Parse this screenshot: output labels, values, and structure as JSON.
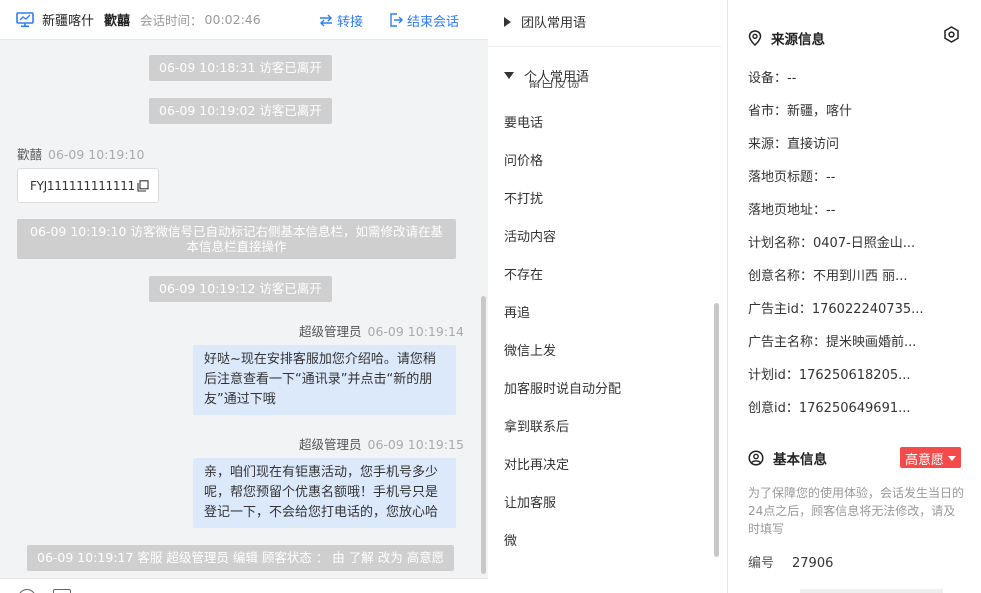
{
  "header": {
    "visitor_region": "新疆喀什",
    "agent_nick": "歡囍",
    "session_label": "会话时间：",
    "session_time": "00:02:46",
    "transfer": "转接",
    "end_session": "结束会话"
  },
  "chat": {
    "sys1": "06-09 10:18:31 访客已离开",
    "sys2": "06-09 10:19:02 访客已离开",
    "msg1_sender": "歡囍",
    "msg1_time": "06-09 10:19:10",
    "msg1_text": "FYJ111111111111",
    "sys3_line1": "06-09 10:19:10 访客微信号已自动标记右侧基本信息栏，如需修改请在基",
    "sys3_line2": "本信息栏直接操作",
    "sys4": "06-09 10:19:12 访客已离开",
    "msg2_sender": "超级管理员",
    "msg2_time": "06-09 10:19:14",
    "msg2_line1": "好哒~现在安排客服加您介绍哈。请您稍",
    "msg2_line2": "后注意查看一下“通讯录”并点击“新的朋",
    "msg2_line3": "友”通过下哦",
    "msg3_sender": "超级管理员",
    "msg3_time": "06-09 10:19:15",
    "msg3_line1": "亲，咱们现在有钜惠活动，您手机号多少",
    "msg3_line2": "呢，帮您预留个优惠名额哦！手机号只是",
    "msg3_line3": "登记一下，不会给您打电话的，您放心哈",
    "sys5": "06-09 10:19:17 客服 超级管理员 编辑 顾客状态 ： 由 了解 改为 高意愿"
  },
  "phrases": {
    "team_group": "团队常用语",
    "personal_group": "个人常用语",
    "partial_item": "留白反馈",
    "items": [
      "要电话",
      "问价格",
      "不打扰",
      "活动内容",
      "不存在",
      "再追",
      "微信上发",
      "加客服时说自动分配",
      "拿到联系后",
      "对比再决定",
      "让加客服",
      "微"
    ]
  },
  "info": {
    "source_title": "来源信息",
    "rows": [
      "设备：--",
      "省市：新疆，喀什",
      "来源：直接访问",
      "落地页标题：--",
      "落地页地址：--",
      "计划名称：0407-日照金山...",
      "创意名称：不用到川西 丽...",
      "广告主id：176022240735...",
      "广告主名称：提米映画婚前...",
      "计划id：176250618205...",
      "创意id：176250649691..."
    ],
    "basic_title": "基本信息",
    "intent_badge": "高意愿",
    "note": "为了保障您的使用体验，会话发生当日的24点之后，顾客信息将无法修改，请及时填写",
    "id_label": "编号",
    "id_value": "27906"
  },
  "colors": {
    "accent": "#2f7df6",
    "bubble": "#dce9fb",
    "system": "#cfcfcf",
    "badge": "#f44a4a"
  }
}
